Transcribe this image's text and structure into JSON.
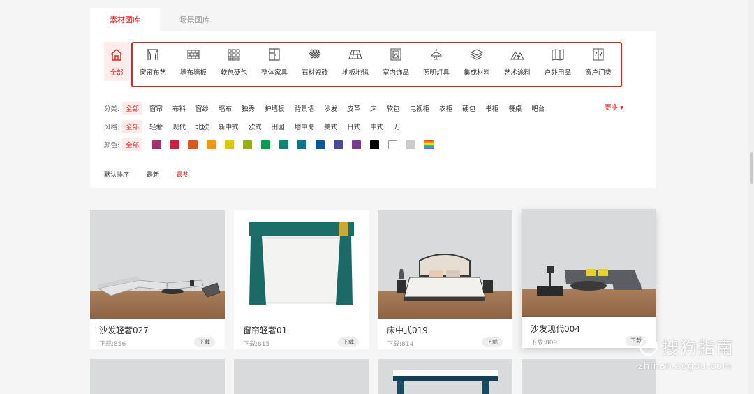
{
  "tabs": [
    "素材图库",
    "场景图库"
  ],
  "categories": [
    "全部",
    "窗帘布艺",
    "墙布墙板",
    "软包硬包",
    "整体家具",
    "石材瓷砖",
    "地板地毯",
    "室内饰品",
    "照明灯具",
    "集成材料",
    "艺术涂料",
    "户外用品",
    "窗户门类"
  ],
  "filters": {
    "type_label": "分类:",
    "types": [
      "全部",
      "窗帘",
      "布料",
      "窗纱",
      "墙布",
      "独秀",
      "护墙板",
      "背景墙",
      "沙发",
      "皮革",
      "床",
      "软包",
      "电视柜",
      "衣柜",
      "硬包",
      "书柜",
      "餐桌",
      "吧台"
    ],
    "more": "更多",
    "style_label": "风格:",
    "styles": [
      "全部",
      "轻奢",
      "现代",
      "北欧",
      "新中式",
      "欧式",
      "田园",
      "地中海",
      "美式",
      "日式",
      "中式",
      "无"
    ],
    "color_label": "颜色:",
    "color_all": "全部",
    "colors": [
      "#a4306b",
      "#d21f3c",
      "#e2541f",
      "#ee9a10",
      "#dcc60a",
      "#9aac1b",
      "#0e9a4a",
      "#0b8774",
      "#0e7590",
      "#0f56a0",
      "#4b4b9c",
      "#7c3b8c",
      "#000000",
      "#ffffff",
      "#cccccc",
      "rainbow"
    ]
  },
  "sort": [
    "默认排序",
    "最新",
    "最热"
  ],
  "cards": [
    {
      "name": "沙发轻奢027",
      "downloads": "下载:856",
      "btn": "下载"
    },
    {
      "name": "窗帘轻奢01",
      "downloads": "下载:815",
      "btn": "下载"
    },
    {
      "name": "床中式019",
      "downloads": "下载:814",
      "btn": "下载"
    },
    {
      "name": "沙发现代004",
      "downloads": "下载:809",
      "btn": "下载"
    }
  ],
  "watermark": {
    "brand": "搜狗指南",
    "url": "zhinan.sogou.com"
  }
}
